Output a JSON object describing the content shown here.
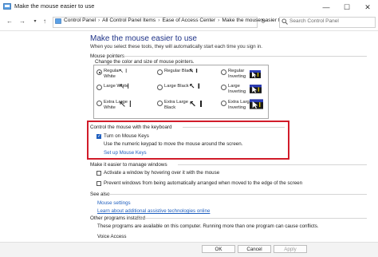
{
  "window": {
    "title": "Make the mouse easier to use",
    "minimize_glyph": "—",
    "maximize_glyph": "☐",
    "close_glyph": "✕"
  },
  "address": {
    "back_glyph": "←",
    "forward_glyph": "→",
    "up_glyph": "↑",
    "breadcrumb": [
      "Control Panel",
      "All Control Panel Items",
      "Ease of Access Center",
      "Make the mouse easier to use"
    ],
    "separator": "›",
    "refresh_glyph": "↻",
    "search_placeholder": "Search Control Panel"
  },
  "main": {
    "title": "Make the mouse easier to use",
    "subtitle": "When you select these tools, they will automatically start each time you sign in."
  },
  "pointers": {
    "header": "Mouse pointers",
    "description": "Change the color and size of mouse pointers.",
    "options": [
      {
        "line1": "Regular",
        "line2": "White",
        "selected": true,
        "icon": "↖ I"
      },
      {
        "line1": "Regular Black",
        "line2": "",
        "selected": false,
        "icon": "↖ I"
      },
      {
        "line1": "Regular",
        "line2": "Inverting",
        "selected": false,
        "icon": "inverting"
      },
      {
        "line1": "Large White",
        "line2": "",
        "selected": false,
        "icon": "↖ I"
      },
      {
        "line1": "Large Black",
        "line2": "",
        "selected": false,
        "icon": "↖ I"
      },
      {
        "line1": "Large",
        "line2": "Inverting",
        "selected": false,
        "icon": "inverting"
      },
      {
        "line1": "Extra Large",
        "line2": "White",
        "selected": false,
        "icon": "↖ I"
      },
      {
        "line1": "Extra Large",
        "line2": "Black",
        "selected": false,
        "icon": "↖ I"
      },
      {
        "line1": "Extra Large",
        "line2": "Inverting",
        "selected": false,
        "icon": "inverting"
      }
    ]
  },
  "keyboard": {
    "header": "Control the mouse with the keyboard",
    "mouse_keys_label": "Turn on Mouse Keys",
    "mouse_keys_checked": true,
    "mouse_keys_desc": "Use the numeric keypad to move the mouse around the screen.",
    "setup_link": "Set up Mouse Keys",
    "highlight_color": "#d11c2a"
  },
  "windows": {
    "header": "Make it easier to manage windows",
    "hover_label": "Activate a window by hovering over it with the mouse",
    "hover_checked": false,
    "arrange_label": "Prevent windows from being automatically arranged when moved to the edge of the screen",
    "arrange_checked": false
  },
  "see_also": {
    "header": "See also",
    "links": [
      "Mouse settings",
      "Learn about additional assistive technologies online"
    ]
  },
  "other_programs": {
    "header": "Other programs installed",
    "description": "These programs are available on this computer. Running more than one program can cause conflicts.",
    "items": [
      "Voice Access"
    ]
  },
  "buttons": {
    "ok": "OK",
    "cancel": "Cancel",
    "apply": "Apply"
  },
  "colors": {
    "link": "#1f5fbf",
    "title": "#1e3287"
  }
}
